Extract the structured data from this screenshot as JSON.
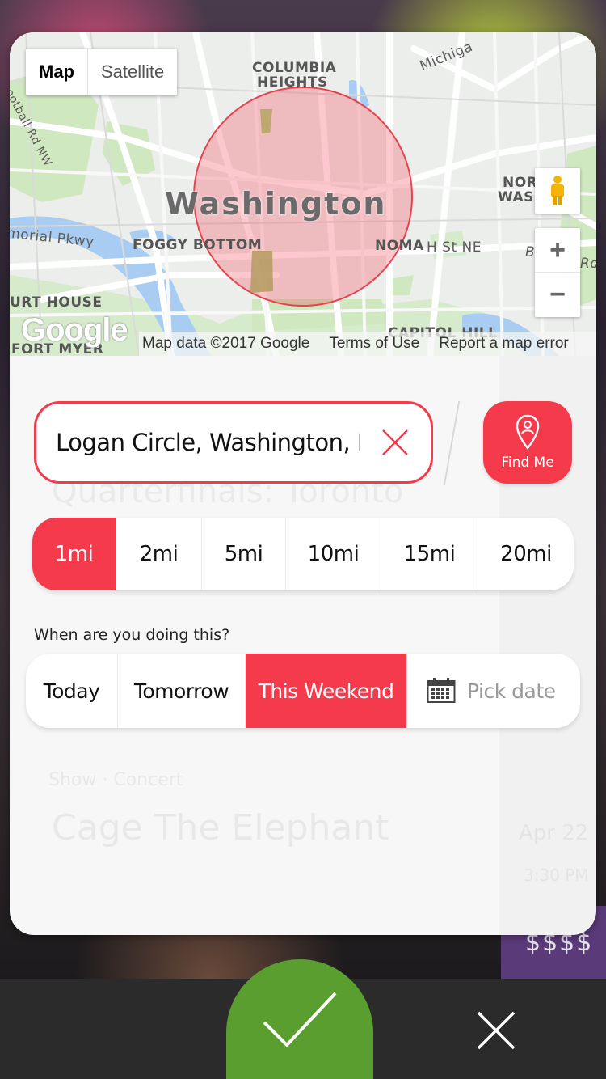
{
  "map": {
    "toggle": {
      "map": "Map",
      "satellite": "Satellite"
    },
    "labels": {
      "washington": "Washington",
      "columbia_heights_1": "COLUMBIA",
      "columbia_heights_2": "HEIGHTS",
      "foggy_bottom": "FOGGY BOTTOM",
      "noma": "NOMA",
      "h_st": "H St NE",
      "north_wash_1": "NORT   T",
      "north_wash_2": "WASH    ON",
      "capitol_hill": "CAPITOL HILL",
      "fort_myer": "FORT MYER",
      "court_house": "URT HOUSE",
      "memorial_pkwy": "morial Pkwy",
      "michigan": "Michiga",
      "football_rd": "ootball Rd NW",
      "b_label": "B",
      "rd_label": "Rd"
    },
    "zoom_in": "+",
    "zoom_out": "−",
    "google": "Google",
    "footer": {
      "map_data": "Map data ©2017 Google",
      "terms": "Terms of Use",
      "report": "Report a map error"
    },
    "radius_color": "#f43a4b"
  },
  "location": {
    "value": "Logan Circle, Washington, DC,",
    "find_me": "Find Me"
  },
  "distance": {
    "options": [
      "1mi",
      "2mi",
      "5mi",
      "10mi",
      "15mi",
      "20mi"
    ],
    "selected": "1mi"
  },
  "when": {
    "label": "When are you doing this?",
    "options": [
      "Today",
      "Tomorrow",
      "This Weekend"
    ],
    "selected": "This Weekend",
    "pick_date": "Pick date"
  },
  "feed_ghost": {
    "title1": "Quarterfinals: Toronto",
    "category": "Show · Concert",
    "title2": "Cage The Elephant",
    "date": "Apr 22",
    "time": "3:30 PM",
    "price": "$$$$"
  },
  "colors": {
    "accent": "#f43a4b",
    "confirm": "#5a9e2f",
    "bar": "#2b2b2b"
  },
  "icons": {
    "clear": "close-icon",
    "find_me": "location-pin-icon",
    "calendar": "calendar-icon",
    "confirm": "checkmark-icon",
    "close": "close-icon",
    "pegman": "pegman-icon"
  }
}
